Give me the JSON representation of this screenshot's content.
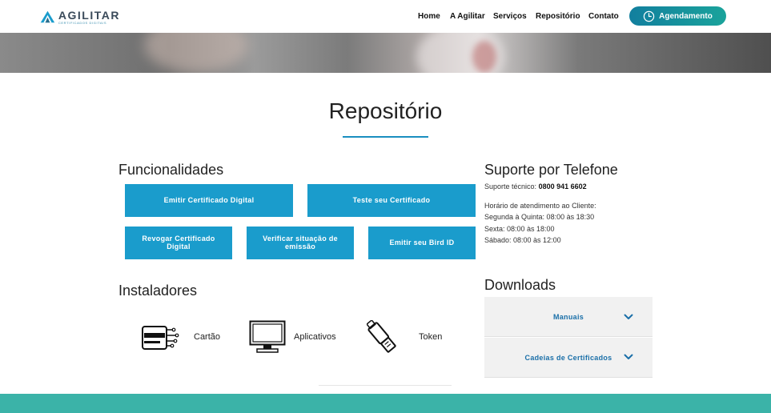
{
  "brand": {
    "name": "AGILITAR",
    "tagline": "CERTIFICADOS DIGITAIS"
  },
  "nav": {
    "items": [
      "Home",
      "A Agilitar",
      "Serviços",
      "Repositório",
      "Contato"
    ],
    "cta_label": "Agendamento"
  },
  "page": {
    "title": "Repositório"
  },
  "funcionalidades": {
    "heading": "Funcionalidades",
    "buttons": [
      "Emitir Certificado Digital",
      "Teste seu Certificado",
      "Revogar Certificado Digital",
      "Verificar situação de emissão",
      "Emitir seu Bird ID"
    ]
  },
  "instaladores": {
    "heading": "Instaladores",
    "items": [
      {
        "label": "Cartão",
        "icon": "card-reader-icon"
      },
      {
        "label": "Aplicativos",
        "icon": "monitor-icon"
      },
      {
        "label": "Token",
        "icon": "usb-token-icon"
      }
    ]
  },
  "suporte": {
    "heading": "Suporte por Telefone",
    "tech_label": "Suporte técnico:",
    "tech_phone": "0800 941 6602",
    "hours_title": "Horário de atendimento ao Cliente:",
    "hours": [
      "Segunda à Quinta: 08:00 às 18:30",
      "Sexta: 08:00 às 18:00",
      "Sábado: 08:00 às 12:00"
    ]
  },
  "downloads": {
    "heading": "Downloads",
    "items": [
      "Manuais",
      "Cadeias de Certificados"
    ]
  },
  "colors": {
    "primary_button": "#1a9ccc",
    "accent_teal": "#1aa39b",
    "footer": "#3bb3a8",
    "link_blue": "#1a6fa8"
  }
}
